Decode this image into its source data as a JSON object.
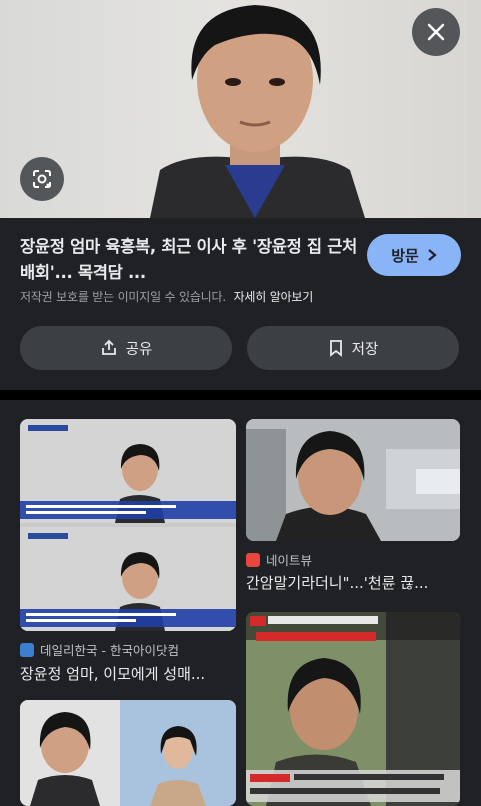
{
  "hero": {
    "close_icon": "close-icon",
    "lens_icon": "google-lens-icon"
  },
  "detail": {
    "title": "장윤정 엄마 육흥복, 최근 이사 후 '장윤정 집 근처 배회'... 목격담 ...",
    "visit_label": "방문",
    "visit_icon": "chevron-right-icon",
    "copyright_text": "저작권 보호를 받는 이미지일 수 있습니다.",
    "learn_more": "자세히 알아보기",
    "share_label": "공유",
    "share_icon": "share-icon",
    "save_label": "저장",
    "save_icon": "bookmark-icon"
  },
  "results": [
    {
      "source": "데일리한국 - 한국아이닷컴",
      "caption": "장윤정 엄마, 이모에게 성매...",
      "favicon_color": "#3c7fd1"
    },
    {
      "source": "네이트뷰",
      "caption": "간암말기라더니\"...'천륜 끊...",
      "favicon_color": "#e8453c"
    },
    {
      "source": "",
      "caption": "",
      "favicon_color": "#888888"
    },
    {
      "source": "",
      "caption": "",
      "favicon_color": "#888888"
    }
  ],
  "colors": {
    "accent": "#8ab4f8",
    "panel_bg": "#202124",
    "button_bg": "#3c4043"
  }
}
